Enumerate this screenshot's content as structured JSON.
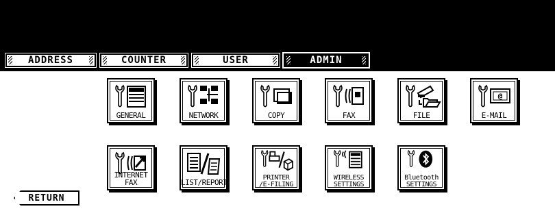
{
  "tabs": [
    {
      "label": "ADDRESS",
      "active": false
    },
    {
      "label": "COUNTER",
      "active": false
    },
    {
      "label": "USER",
      "active": false
    },
    {
      "label": "ADMIN",
      "active": true
    }
  ],
  "tiles": [
    {
      "label": "GENERAL",
      "icon": "general-settings-icon"
    },
    {
      "label": "NETWORK",
      "icon": "network-settings-icon"
    },
    {
      "label": "COPY",
      "icon": "copy-settings-icon"
    },
    {
      "label": "FAX",
      "icon": "fax-settings-icon"
    },
    {
      "label": "FILE",
      "icon": "file-settings-icon"
    },
    {
      "label": "E-MAIL",
      "icon": "email-settings-icon"
    },
    {
      "label": "INTERNET FAX",
      "icon": "internet-fax-settings-icon"
    },
    {
      "label": "LIST/REPORT",
      "icon": "list-report-icon"
    },
    {
      "label_line1": "PRINTER",
      "label_line2": "/E-FILING",
      "icon": "printer-efiling-settings-icon"
    },
    {
      "label_line1": "WIRELESS",
      "label_line2": "SETTINGS",
      "icon": "wireless-settings-icon"
    },
    {
      "label_line1": "Bluetooth",
      "label_line2": "SETTINGS",
      "icon": "bluetooth-settings-icon"
    }
  ],
  "return_label": "RETURN"
}
